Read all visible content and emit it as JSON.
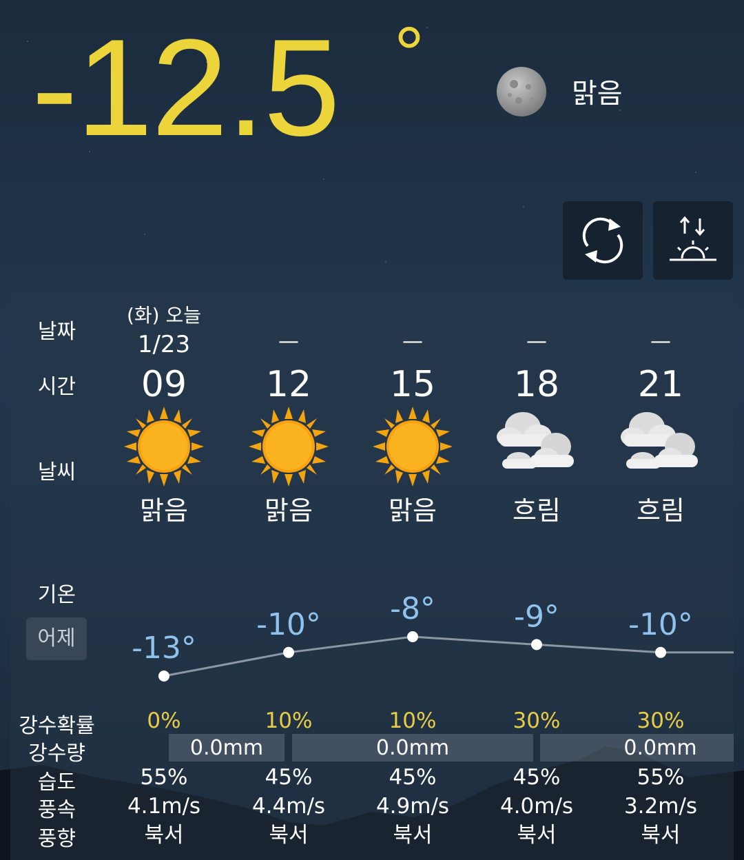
{
  "current": {
    "temperature": "-12.5",
    "degree_symbol": "°",
    "condition": "맑음",
    "icon": "moon-icon"
  },
  "buttons": {
    "refresh_icon": "refresh-icon",
    "sunrise_icon": "sunrise-sunset-icon"
  },
  "labels": {
    "date": "날짜",
    "time": "시간",
    "weather": "날씨",
    "temperature": "기온",
    "yesterday": "어제",
    "precip_prob": "강수확률",
    "precip_amount": "강수량",
    "humidity": "습도",
    "wind_speed": "풍속",
    "wind_dir": "풍향"
  },
  "forecast": {
    "date_top": "(화) 오늘",
    "date_sub": "1/23",
    "dash": "—",
    "slots": [
      {
        "hour": "09",
        "condition": "맑음",
        "icon": "sun-icon",
        "temp": "-13°",
        "pop": "0%",
        "humidity": "55%",
        "wind": "4.1m/s",
        "dir": "북서"
      },
      {
        "hour": "12",
        "condition": "맑음",
        "icon": "sun-icon",
        "temp": "-10°",
        "pop": "10%",
        "humidity": "45%",
        "wind": "4.4m/s",
        "dir": "북서"
      },
      {
        "hour": "15",
        "condition": "맑음",
        "icon": "sun-icon",
        "temp": "-8°",
        "pop": "10%",
        "humidity": "45%",
        "wind": "4.9m/s",
        "dir": "북서"
      },
      {
        "hour": "18",
        "condition": "흐림",
        "icon": "cloudy-icon",
        "temp": "-9°",
        "pop": "30%",
        "humidity": "45%",
        "wind": "4.0m/s",
        "dir": "북서"
      },
      {
        "hour": "21",
        "condition": "흐림",
        "icon": "cloudy-icon",
        "temp": "-10°",
        "pop": "30%",
        "humidity": "55%",
        "wind": "3.2m/s",
        "dir": "북서"
      }
    ],
    "rain_amounts": [
      "0.0mm",
      "0.0mm",
      "0.0mm"
    ]
  },
  "colors": {
    "accent_temp": "#ecd53b",
    "chart_text": "#8fc3ee",
    "pop_text": "#e8cc45"
  }
}
